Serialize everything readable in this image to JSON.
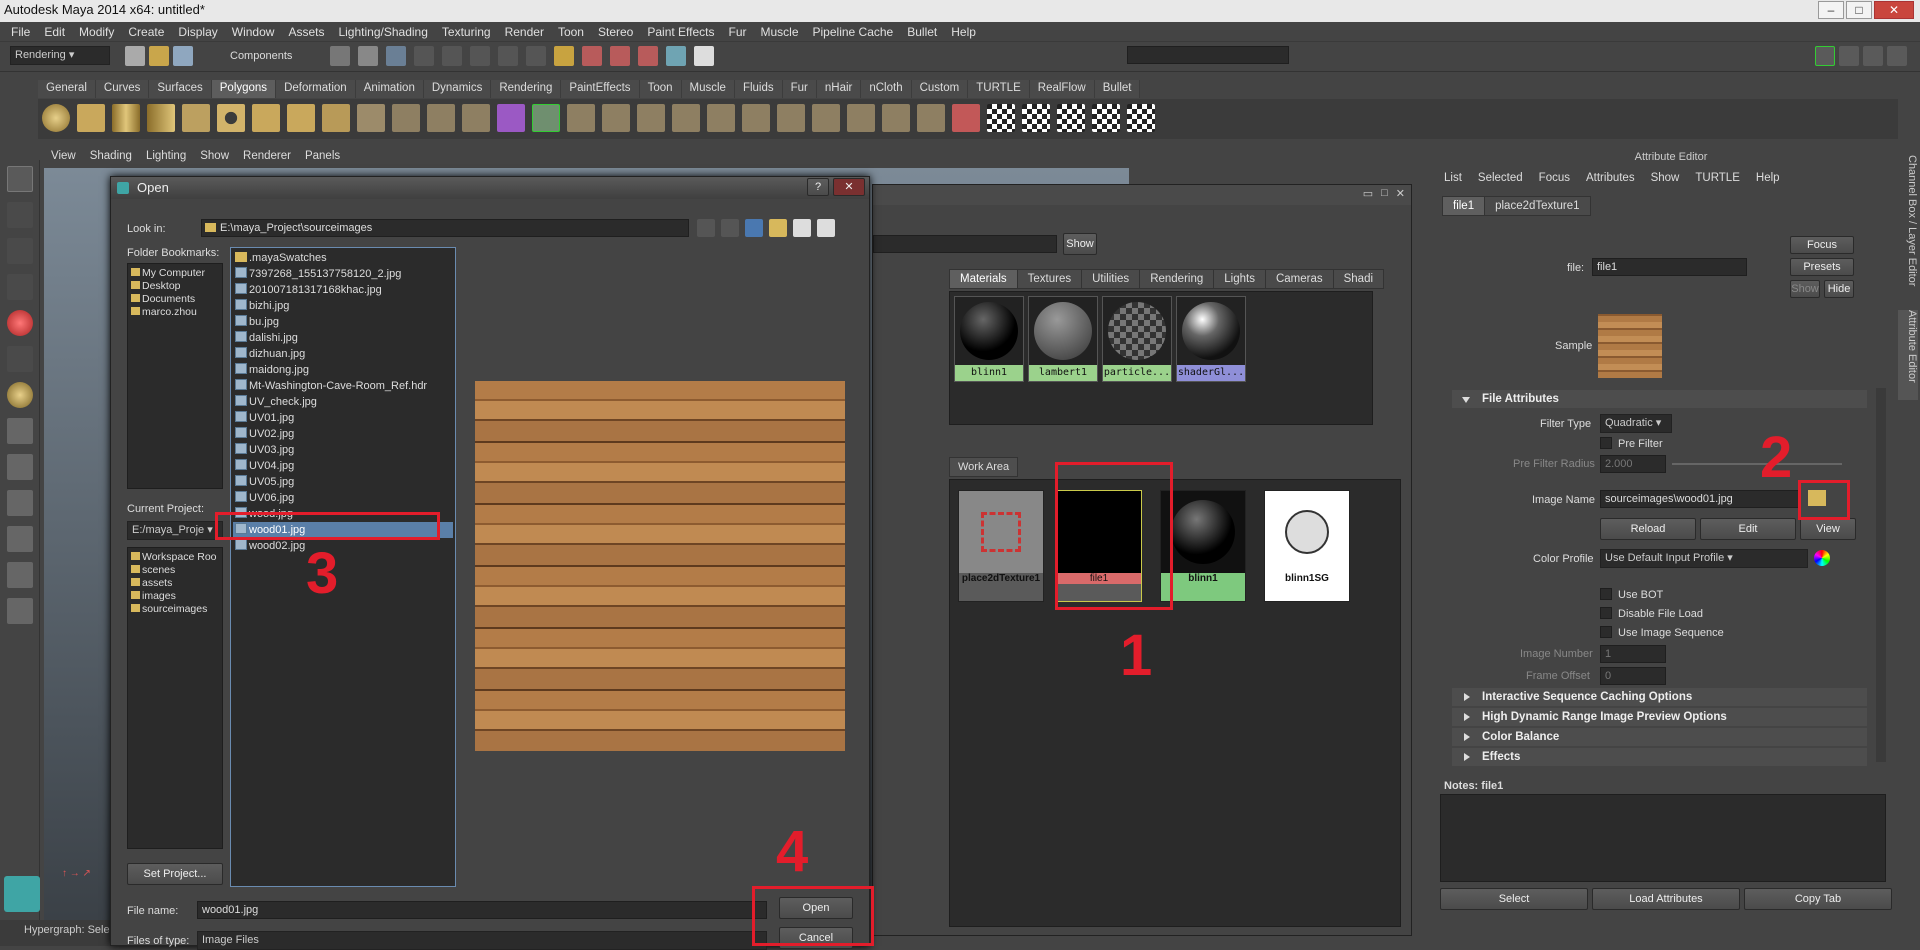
{
  "window": {
    "title": "Autodesk Maya 2014 x64: untitled*"
  },
  "menubar": [
    "File",
    "Edit",
    "Modify",
    "Create",
    "Display",
    "Window",
    "Assets",
    "Lighting/Shading",
    "Texturing",
    "Render",
    "Toon",
    "Stereo",
    "Paint Effects",
    "Fur",
    "Muscle",
    "Pipeline Cache",
    "Bullet",
    "Help"
  ],
  "status": {
    "menuset": "Rendering",
    "mode": "Components"
  },
  "shelf_tabs": [
    "General",
    "Curves",
    "Surfaces",
    "Polygons",
    "Deformation",
    "Animation",
    "Dynamics",
    "Rendering",
    "PaintEffects",
    "Toon",
    "Muscle",
    "Fluids",
    "Fur",
    "nHair",
    "nCloth",
    "Custom",
    "TURTLE",
    "RealFlow",
    "Bullet"
  ],
  "shelf_active": "Polygons",
  "viewport_menu": [
    "View",
    "Shading",
    "Lighting",
    "Show",
    "Renderer",
    "Panels"
  ],
  "open_dialog": {
    "title": "Open",
    "look_in_label": "Look in:",
    "look_in_value": "E:\\maya_Project\\sourceimages",
    "bookmarks_label": "Folder Bookmarks:",
    "bookmarks": [
      "My Computer",
      "Desktop",
      "Documents",
      "marco.zhou"
    ],
    "files": [
      ".mayaSwatches",
      "7397268_155137758120_2.jpg",
      "201007181317168khac.jpg",
      "bizhi.jpg",
      "bu.jpg",
      "dalishi.jpg",
      "dizhuan.jpg",
      "maidong.jpg",
      "Mt-Washington-Cave-Room_Ref.hdr",
      "UV_check.jpg",
      "UV01.jpg",
      "UV02.jpg",
      "UV03.jpg",
      "UV04.jpg",
      "UV05.jpg",
      "UV06.jpg",
      "wood.jpg",
      "wood01.jpg",
      "wood02.jpg"
    ],
    "selected_file": "wood01.jpg",
    "current_project_label": "Current Project:",
    "current_project": "E:/maya_Proje",
    "project_folders": [
      "Workspace Roo",
      "scenes",
      "assets",
      "images",
      "sourceimages"
    ],
    "set_project_button": "Set Project...",
    "file_name_label": "File name:",
    "file_name_value": "wood01.jpg",
    "file_type_label": "Files of type:",
    "file_type_value": "Image Files",
    "open_button": "Open",
    "cancel_button": "Cancel",
    "help_button": "?",
    "close_button": "✕"
  },
  "hypershade": {
    "show_button": "Show",
    "tabs": [
      "Materials",
      "Textures",
      "Utilities",
      "Rendering",
      "Lights",
      "Cameras",
      "Shadi"
    ],
    "materials": [
      "blinn1",
      "lambert1",
      "particle...",
      "shaderGl..."
    ],
    "work_area_label": "Work Area",
    "nodes": [
      "place2dTexture1",
      "file1",
      "blinn1",
      "blinn1SG"
    ]
  },
  "attribute_editor": {
    "title": "Attribute Editor",
    "menu": [
      "List",
      "Selected",
      "Focus",
      "Attributes",
      "Show",
      "TURTLE",
      "Help"
    ],
    "tabs": [
      "file1",
      "place2dTexture1"
    ],
    "file_label": "file:",
    "file_value": "file1",
    "focus_button": "Focus",
    "presets_button": "Presets",
    "show_button": "Show",
    "hide_button": "Hide",
    "sample_label": "Sample",
    "file_attributes_header": "File Attributes",
    "filter_type_label": "Filter Type",
    "filter_type_value": "Quadratic",
    "pre_filter_label": "Pre Filter",
    "pre_filter_radius_label": "Pre Filter Radius",
    "pre_filter_radius_value": "2.000",
    "image_name_label": "Image Name",
    "image_name_value": "sourceimages\\wood01.jpg",
    "reload_button": "Reload",
    "edit_button": "Edit",
    "view_button": "View",
    "color_profile_label": "Color Profile",
    "color_profile_value": "Use Default Input Profile",
    "use_bot_label": "Use BOT",
    "disable_file_load_label": "Disable File Load",
    "use_image_sequence_label": "Use Image Sequence",
    "image_number_label": "Image Number",
    "image_number_value": "1",
    "frame_offset_label": "Frame Offset",
    "frame_offset_value": "0",
    "sections": [
      "Interactive Sequence Caching Options",
      "High Dynamic Range Image Preview Options",
      "Color Balance",
      "Effects"
    ],
    "notes_label": "Notes:  file1",
    "bottom_buttons": [
      "Select",
      "Load Attributes",
      "Copy Tab"
    ]
  },
  "side_tabs": [
    "Channel Box / Layer Editor",
    "Attribute Editor"
  ],
  "helpline": "Hypergraph: Sele",
  "annotations": [
    "1",
    "2",
    "3",
    "4"
  ],
  "colors": {
    "annotation": "#e31d2b",
    "selection": "#5a7fa8",
    "file_node": "#d96a6a",
    "blinn_node": "#7ec97e"
  }
}
